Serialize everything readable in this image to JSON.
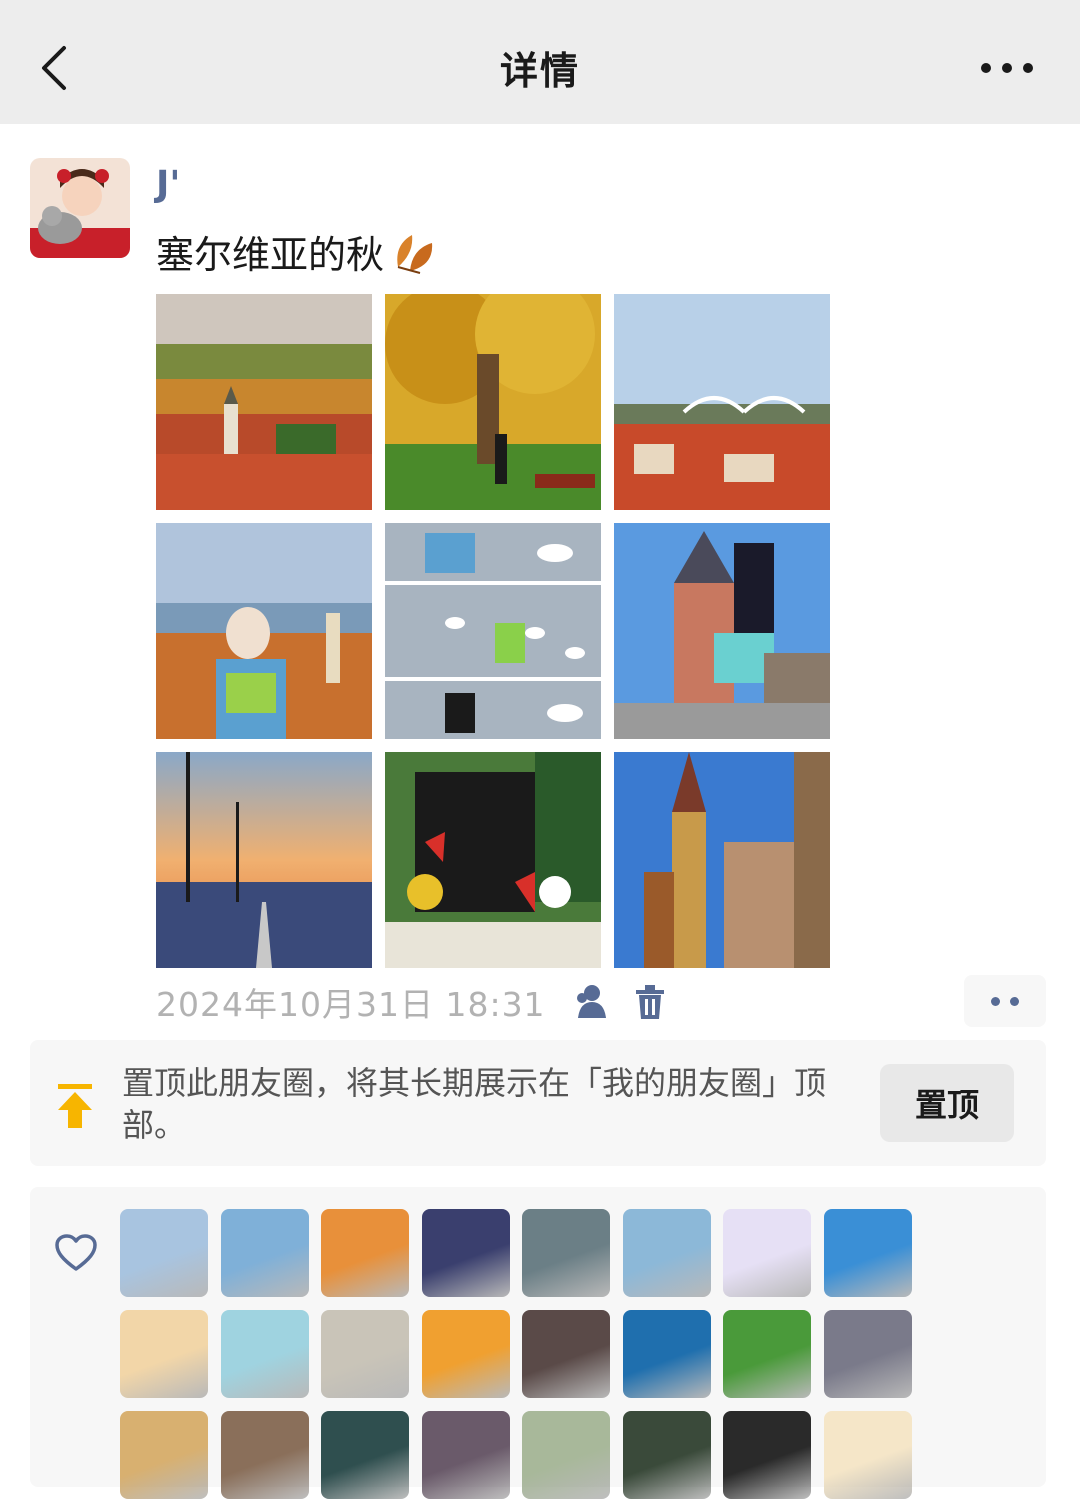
{
  "header": {
    "title": "详情"
  },
  "post": {
    "username": "J'",
    "text": "塞尔维亚的秋",
    "timestamp": "2024年10月31日 18:31",
    "photos": [
      {
        "icon": "city-autumn-photo"
      },
      {
        "icon": "tree-autumn-photo"
      },
      {
        "icon": "bridge-rooftops-photo"
      },
      {
        "icon": "woman-rooftops-photo"
      },
      {
        "icon": "swans-collage-photo"
      },
      {
        "icon": "tower-woman-photo"
      },
      {
        "icon": "sunset-bridge-photo"
      },
      {
        "icon": "memorial-stone-photo"
      },
      {
        "icon": "cathedral-photo"
      }
    ]
  },
  "pin": {
    "text": "置顶此朋友圈，将其长期展示在「我的朋友圈」顶部。",
    "button": "置顶",
    "accent": "#f7b500"
  },
  "likes": {
    "avatars": [
      "#a8c4e0",
      "#7fb0d8",
      "#e8903a",
      "#3a3f6e",
      "#6b7f86",
      "#8cb8d8",
      "#e6e0f5",
      "#3a8fd6",
      "#f2d6a8",
      "#9fd3e0",
      "#c9c4b8",
      "#f0a030",
      "#5a4a48",
      "#1f6fae",
      "#4a9a3a",
      "#7a7a8a",
      "#d8b070",
      "#8a6f5a",
      "#2f4f4f",
      "#6a5a6a",
      "#a8b89a",
      "#3a4a3a",
      "#2a2a2a",
      "#f5e6c8"
    ]
  },
  "colors": {
    "link": "#576b95",
    "muted": "#b2b2b2",
    "header_bg": "#ededed"
  }
}
